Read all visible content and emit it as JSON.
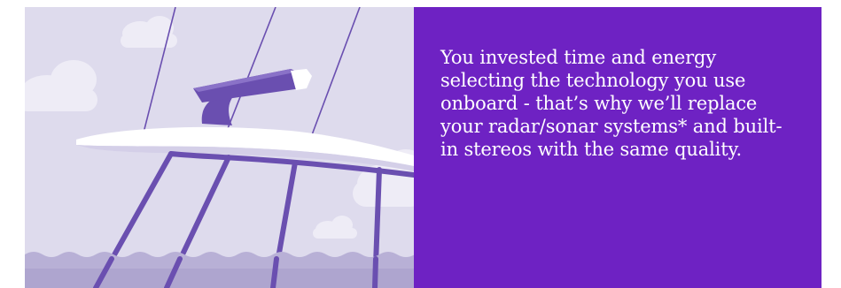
{
  "panel": {
    "body_text": "You invested time and energy selecting the technology you use onboard - that’s why we’ll replace your radar/sonar systems* and built-in stereos with the same quality.",
    "background_color": "#6e22c3",
    "text_color": "#ffffff"
  },
  "illustration": {
    "subject": "boat-deck-illustration",
    "background_color": "#dedbed",
    "accent_color": "#6a4fb0",
    "water_color": "#b8b0d6"
  }
}
